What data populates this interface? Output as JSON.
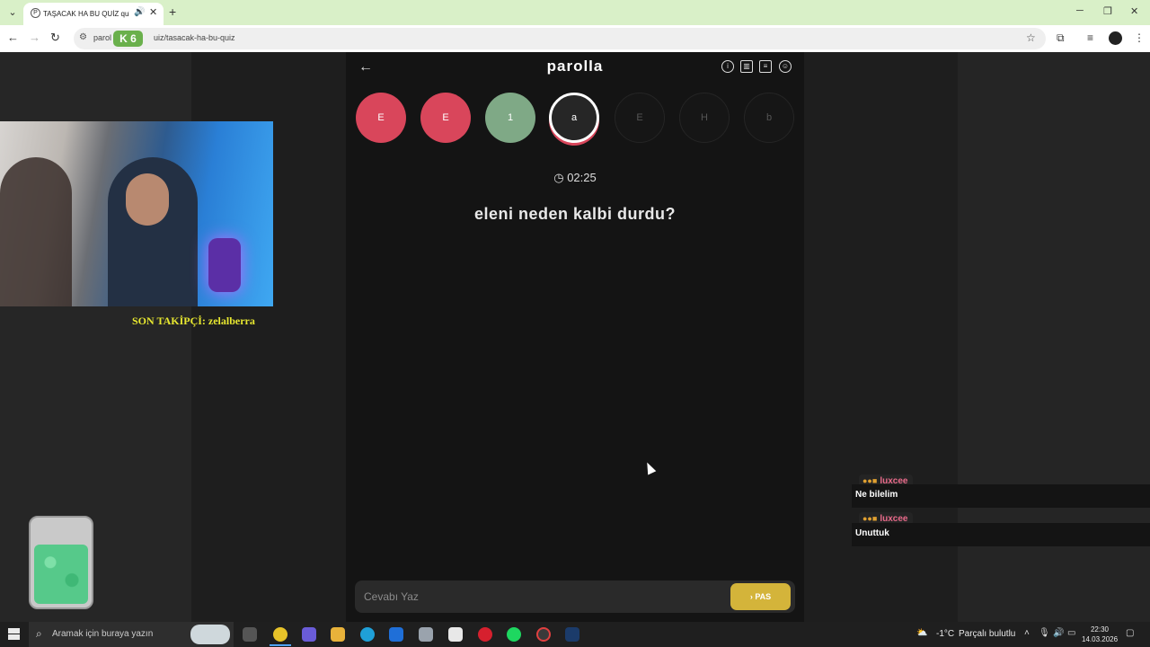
{
  "browser": {
    "tab_title": "TAŞACAK HA BU QUİZ quiz",
    "favicon": "P",
    "url_site": "parol",
    "url_rest": "uiz/tasacak-ha-bu-quiz",
    "badge": "K 6",
    "new_tab": "+"
  },
  "stream": {
    "follower_text": "SON TAKİPÇİ: zelalberra"
  },
  "game": {
    "title": "parolla",
    "timer": "02:25",
    "question": "eleni neden kalbi durdu?",
    "letters": [
      {
        "letter": "E",
        "state": "wrong"
      },
      {
        "letter": "E",
        "state": "wrong"
      },
      {
        "letter": "1",
        "state": "right"
      },
      {
        "letter": "a",
        "state": "active"
      },
      {
        "letter": "E",
        "state": "empty"
      },
      {
        "letter": "H",
        "state": "empty"
      },
      {
        "letter": "b",
        "state": "empty"
      }
    ],
    "answer_placeholder": "Cevabı Yaz",
    "pass_label": "› PAS"
  },
  "chat": [
    {
      "user": "luxcee",
      "message": "Ne bilelim"
    },
    {
      "user": "luxcee",
      "message": "Unuttuk"
    }
  ],
  "taskbar": {
    "search_placeholder": "Aramak için buraya yazın",
    "weather_temp": "-1°C",
    "weather_desc": "Parçalı bulutlu",
    "time": "22:30",
    "date": "14.03.2026"
  },
  "colors": {
    "wrong": "#d9465b",
    "right": "#7fa986",
    "pass_button": "#d4b43a",
    "follower_text": "#e8e830",
    "tab_bar": "#d9f0c8"
  }
}
